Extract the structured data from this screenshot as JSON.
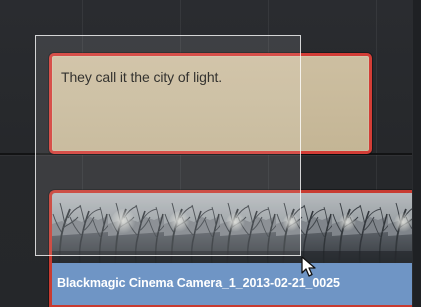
{
  "timeline": {
    "subtitle_track": {
      "clip_text": "They call it the city of light."
    },
    "video_track": {
      "clip_name": "Blackmagic Cinema Camera_1_2013-02-21_0025"
    }
  },
  "icons": {
    "pointer": "arrow-cursor-icon"
  },
  "colors": {
    "timeline_background": "#25272a",
    "selected_clip_border": "#d33d36",
    "subtitle_clip_fill": "#c8b999",
    "video_clip_label": "#6f95c5",
    "marquee": "#ffffff"
  }
}
